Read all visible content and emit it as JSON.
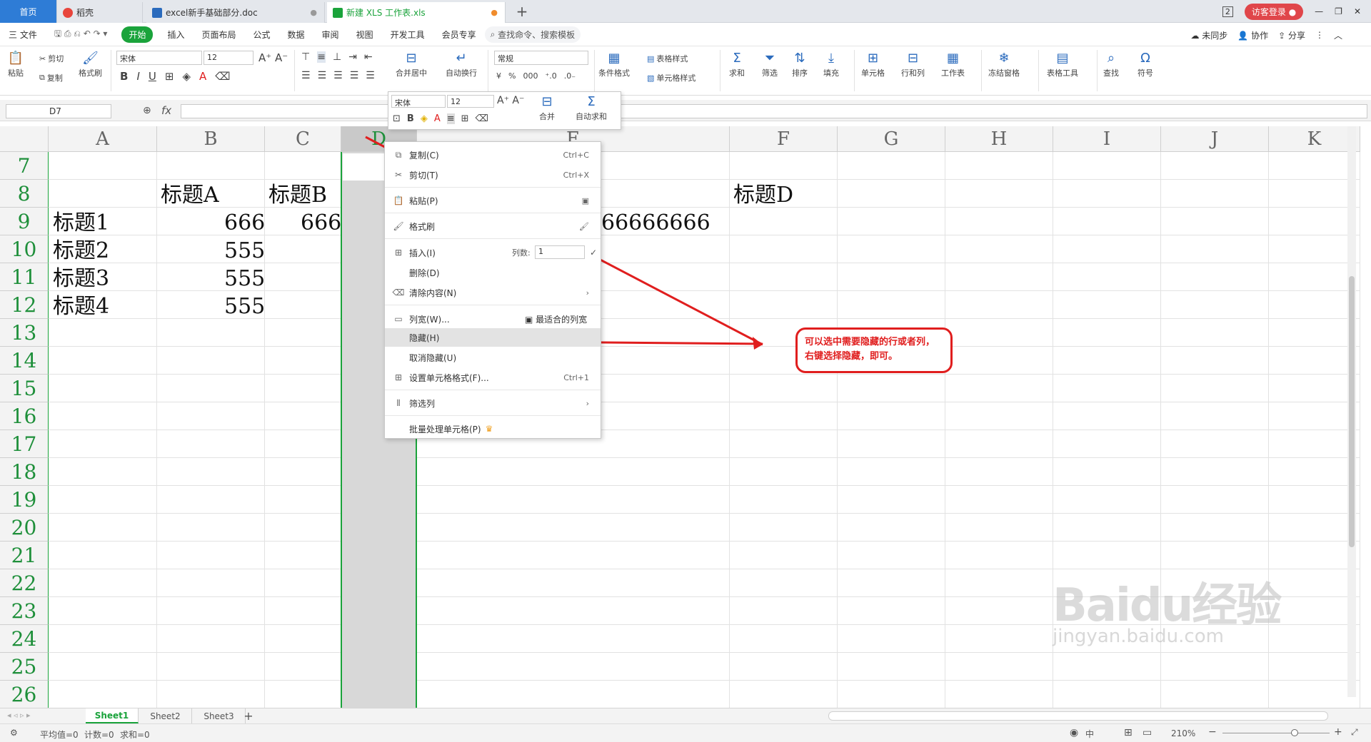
{
  "tabs": {
    "home": "首页",
    "doc1": "稻壳",
    "doc2": "excel新手基础部分.doc",
    "xls": "新建 XLS 工作表.xls",
    "plus": "+"
  },
  "window": {
    "login": "访客登录",
    "badge": "2"
  },
  "menu": {
    "file": "三 文件",
    "start": "开始",
    "items": [
      "插入",
      "页面布局",
      "公式",
      "数据",
      "审阅",
      "视图",
      "开发工具",
      "会员专享"
    ],
    "search": "查找命令、搜索模板",
    "right": [
      "未同步",
      "协作",
      "分享"
    ]
  },
  "ribbon": {
    "paste": "粘贴",
    "cut": "剪切",
    "copy": "复制",
    "format_painter": "格式刷",
    "font_name": "宋体",
    "font_size": "12",
    "merge": "合并居中",
    "wrap": "自动换行",
    "number_format": "常规",
    "cond_format": "条件格式",
    "table_style": "表格样式",
    "cell_style": "单元格样式",
    "sum": "求和",
    "filter": "筛选",
    "sort": "排序",
    "fill": "填充",
    "cell": "单元格",
    "rowcol": "行和列",
    "sheet": "工作表",
    "freeze": "冻结窗格",
    "table_tools": "表格工具",
    "find": "查找",
    "symbol": "符号"
  },
  "formula": {
    "namebox": "D7",
    "fx": "fx"
  },
  "columns": [
    "A",
    "B",
    "C",
    "D",
    "E",
    "F",
    "G",
    "H",
    "I",
    "J",
    "K"
  ],
  "rows": [
    "7",
    "8",
    "9",
    "10",
    "11",
    "12",
    "13",
    "14",
    "15",
    "16",
    "17",
    "18",
    "19",
    "20",
    "21",
    "22",
    "23",
    "24",
    "25",
    "26"
  ],
  "cells": {
    "B8": "标题A",
    "C8": "标题B",
    "F8": "标题D",
    "A9": "标题1",
    "B9": "666",
    "C9": "666",
    "E9": "66666666",
    "A10": "标题2",
    "B10": "555",
    "A11": "标题3",
    "B11": "555",
    "A12": "标题4",
    "B12": "555"
  },
  "minitoolbar": {
    "font": "宋体",
    "size": "12",
    "merge": "合并",
    "autosum": "自动求和"
  },
  "context_menu": {
    "copy": "复制(C)",
    "copy_sc": "Ctrl+C",
    "cut": "剪切(T)",
    "cut_sc": "Ctrl+X",
    "paste": "粘贴(P)",
    "format_painter": "格式刷",
    "insert": "插入(I)",
    "cols_label": "列数:",
    "cols_value": "1",
    "delete": "删除(D)",
    "clear": "清除内容(N)",
    "col_width": "列宽(W)...",
    "best_fit": "最适合的列宽",
    "hide": "隐藏(H)",
    "unhide": "取消隐藏(U)",
    "format_cells": "设置单元格格式(F)...",
    "format_cells_sc": "Ctrl+1",
    "filter_col": "筛选列",
    "batch": "批量处理单元格(P)"
  },
  "annotation": "可以选中需要隐藏的行或者列，右键选择隐藏，即可。",
  "sheets": [
    "Sheet1",
    "Sheet2",
    "Sheet3"
  ],
  "status": {
    "avg": "平均值=0",
    "count": "计数=0",
    "sum": "求和=0",
    "zoom": "210%"
  },
  "watermark": {
    "brand": "Baidu经验",
    "url": "jingyan.baidu.com"
  },
  "colors": {
    "accent": "#1aa33b",
    "tab_home": "#2e7cd6",
    "annotation": "#e01e1e"
  }
}
